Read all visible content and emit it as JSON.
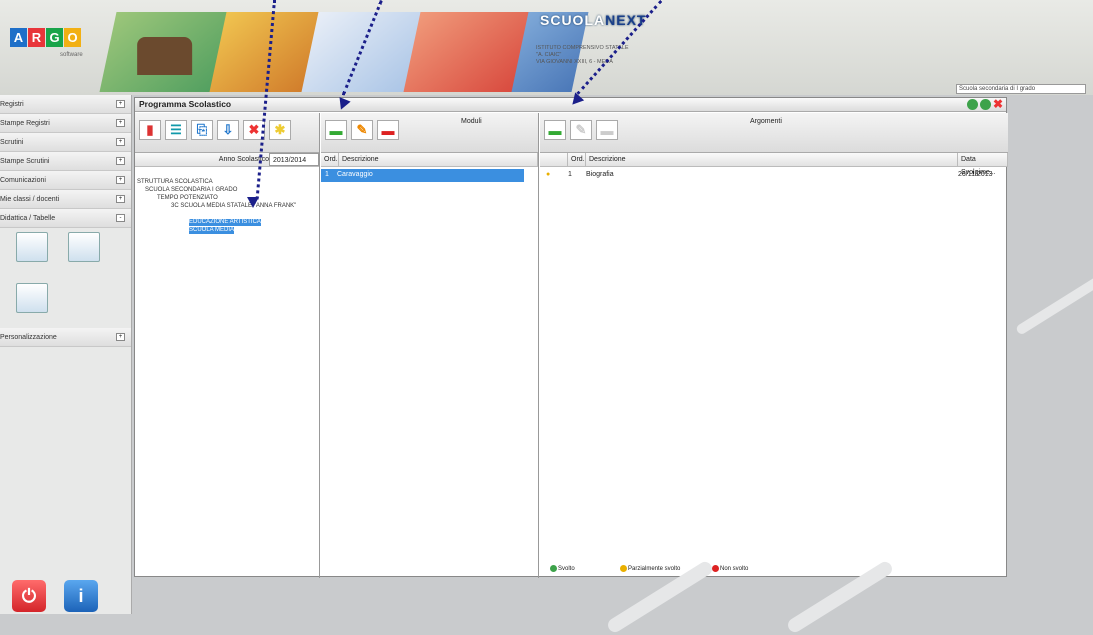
{
  "brand": {
    "logo_letters": [
      "A",
      "R",
      "G",
      "O"
    ],
    "logo_sub": "software",
    "app_name_a": "SCUOLA",
    "app_name_b": "NEXT",
    "school_lines": [
      "ISTITUTO COMPRENSIVO STATALE",
      "\"A. CIAIC\"",
      "VIA GIOVANNI XXIII, 6 - MEDA"
    ],
    "search_value": "Scuola secondaria di I grado"
  },
  "sidebar": {
    "items": [
      "Registri",
      "Stampe Registri",
      "Scrutini",
      "Stampe Scrutini",
      "Comunicazioni",
      "Mie classi / docenti",
      "Didattica / Tabelle"
    ],
    "toggle_open": "-",
    "toggle_closed": "+",
    "extra_item": "Personalizzazione"
  },
  "main": {
    "title": "Programma Scolastico",
    "tree": {
      "year_label": "Anno Scolastico",
      "year_value": "2013/2014",
      "nodes": [
        "STRUTTURA SCOLASTICA",
        "SCUOLA SECONDARIA I GRADO",
        "TEMPO POTENZIATO",
        "3C SCUOLA MEDIA STATALE \"ANNA FRANK\"",
        "EDUCAZIONE ARTISTICA",
        "SCUOLA MEDIA"
      ]
    },
    "moduli": {
      "title": "Moduli",
      "col_ord": "Ord.",
      "col_desc": "Descrizione",
      "rows": [
        {
          "ord": "1",
          "desc": "Caravaggio"
        }
      ]
    },
    "argomenti": {
      "title": "Argomenti",
      "col_ord": "Ord.",
      "col_desc": "Descrizione",
      "col_date": "Data Svolgime...",
      "rows": [
        {
          "ord": "1",
          "desc": "Biografia",
          "date": "26/11/2013"
        }
      ],
      "legend": [
        "Svolto",
        "Parzialmente svolto",
        "Non svolto"
      ]
    }
  },
  "colors": {
    "accent_blue": "#3b8fe0",
    "arrow": "#1b1f8a"
  }
}
